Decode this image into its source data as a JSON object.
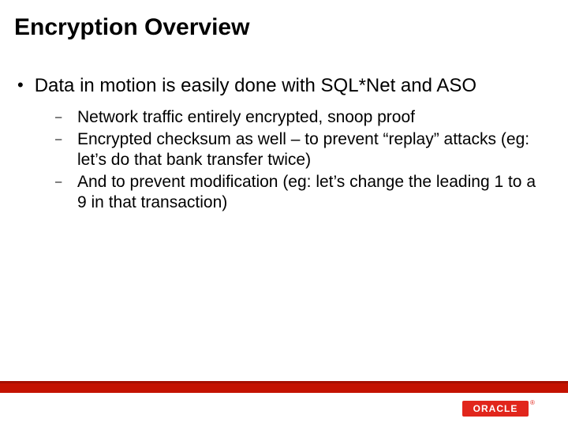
{
  "title": "Encryption Overview",
  "bullet1": "Data in motion is easily done with SQL*Net and ASO",
  "sub": {
    "a": "Network traffic entirely encrypted, snoop proof",
    "b": "Encrypted checksum as well – to prevent “replay” attacks (eg: let’s do that bank transfer twice)",
    "c": "And to prevent modification (eg: let’s change the leading 1 to a 9 in that transaction)"
  },
  "logo_text": "ORACLE",
  "reg": "®"
}
